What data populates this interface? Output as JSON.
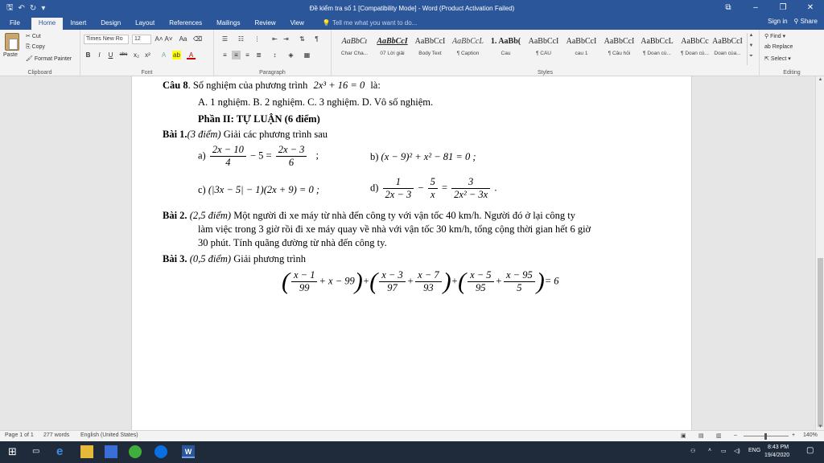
{
  "window": {
    "title": "Đề kiểm tra số 1 [Compatibility Mode] - Word (Product Activation Failed)",
    "controls": [
      "⧉",
      "–",
      "❐",
      "✕"
    ]
  },
  "tabs": {
    "file": "File",
    "items": [
      "Home",
      "Insert",
      "Design",
      "Layout",
      "References",
      "Mailings",
      "Review",
      "View"
    ],
    "tell_me": "Tell me what you want to do...",
    "sign_in": "Sign in",
    "share": "Share"
  },
  "ribbon": {
    "clipboard": {
      "paste": "Paste",
      "cut": "Cut",
      "copy": "Copy",
      "format_painter": "Format Painter",
      "label": "Clipboard"
    },
    "font": {
      "name": "Times New Ro",
      "size": "12",
      "label": "Font"
    },
    "paragraph": {
      "label": "Paragraph"
    },
    "styles": {
      "label": "Styles",
      "items": [
        {
          "preview": "AaBbCı",
          "name": "Char Cha..."
        },
        {
          "preview": "AaBbCcI",
          "name": "07 Lời giải"
        },
        {
          "preview": "AaBbCcI",
          "name": "Body Text"
        },
        {
          "preview": "AaBbCcL",
          "name": "¶ Caption"
        },
        {
          "preview": "1. AaBb(",
          "name": "Cau"
        },
        {
          "preview": "AaBbCcI",
          "name": "¶ CÂU"
        },
        {
          "preview": "AaBbCcI",
          "name": "cau 1"
        },
        {
          "preview": "AaBbCcI",
          "name": "¶ Câu hỏi"
        },
        {
          "preview": "AaBbCcL",
          "name": "¶ Doan cù..."
        },
        {
          "preview": "AaBbCc",
          "name": "¶ Doan cù..."
        },
        {
          "preview": "AaBbCcI",
          "name": "Doan cùa..."
        }
      ]
    },
    "editing": {
      "find": "Find",
      "replace": "Replace",
      "select": "Select",
      "label": "Editing"
    }
  },
  "document": {
    "q8_label": "Câu 8",
    "q8_text": ". Số nghiệm của phương trình",
    "q8_eq": "2x³ + 16 = 0",
    "q8_tail": "là:",
    "q8_options": "A. 1 nghiệm.   B. 2 nghiệm.   C. 3 nghiệm.   D. Vô số nghiệm.",
    "part2_title": "Phần II: TỰ LUẬN (6 điểm)",
    "bai1_label": "Bài 1.",
    "bai1_points": "(3 điểm)",
    "bai1_text": " Giải các phương trình sau",
    "bai1_a_label": "a)",
    "bai1_a": {
      "f1_num": "2x − 10",
      "f1_den": "4",
      "mid": "− 5 =",
      "f2_num": "2x − 3",
      "f2_den": "6",
      "tail": ";"
    },
    "bai1_b_label": "b)",
    "bai1_b": "(x − 9)² + x² − 81 = 0 ;",
    "bai1_c_label": "c)",
    "bai1_c": "(|3x − 5| − 1)(2x + 9) = 0 ;",
    "bai1_d_label": "d)",
    "bai1_d": {
      "f1_num": "1",
      "f1_den": "2x − 3",
      "op1": "−",
      "f2_num": "5",
      "f2_den": "x",
      "op2": "=",
      "f3_num": "3",
      "f3_den": "2x² − 3x",
      "tail": "."
    },
    "bai2_label": "Bài 2.",
    "bai2_points": "(2,5 điểm)",
    "bai2_line1": " Một người đi xe máy từ nhà đến công ty  với vận tốc 40 km/h. Người đó ở lại công ty",
    "bai2_line2": "làm việc trong 3 giờ rồi đi xe máy quay về nhà với vận tốc 30 km/h, tổng cộng thời gian hết 6 giờ",
    "bai2_line3": "30 phút. Tính quãng đường từ nhà đến công ty.",
    "bai3_label": "Bài 3.",
    "bai3_points": "(0,5 điểm)",
    "bai3_text": " Giải phương trình",
    "bai3_eq": {
      "g1_num": "x − 1",
      "g1_den": "99",
      "g1_tail": "+ x − 99",
      "g2_f1_num": "x − 3",
      "g2_f1_den": "97",
      "g2_f2_num": "x − 7",
      "g2_f2_den": "93",
      "g3_f1_num": "x − 5",
      "g3_f1_den": "95",
      "g3_f2_num": "x − 95",
      "g3_f2_den": "5",
      "rhs": "= 6"
    }
  },
  "status": {
    "page": "Page 1 of 1",
    "words": "277 words",
    "language": "English (United States)",
    "zoom": "140%"
  },
  "taskbar": {
    "time": "8:43 PM",
    "date": "19/4/2020",
    "lang": "ENG"
  }
}
